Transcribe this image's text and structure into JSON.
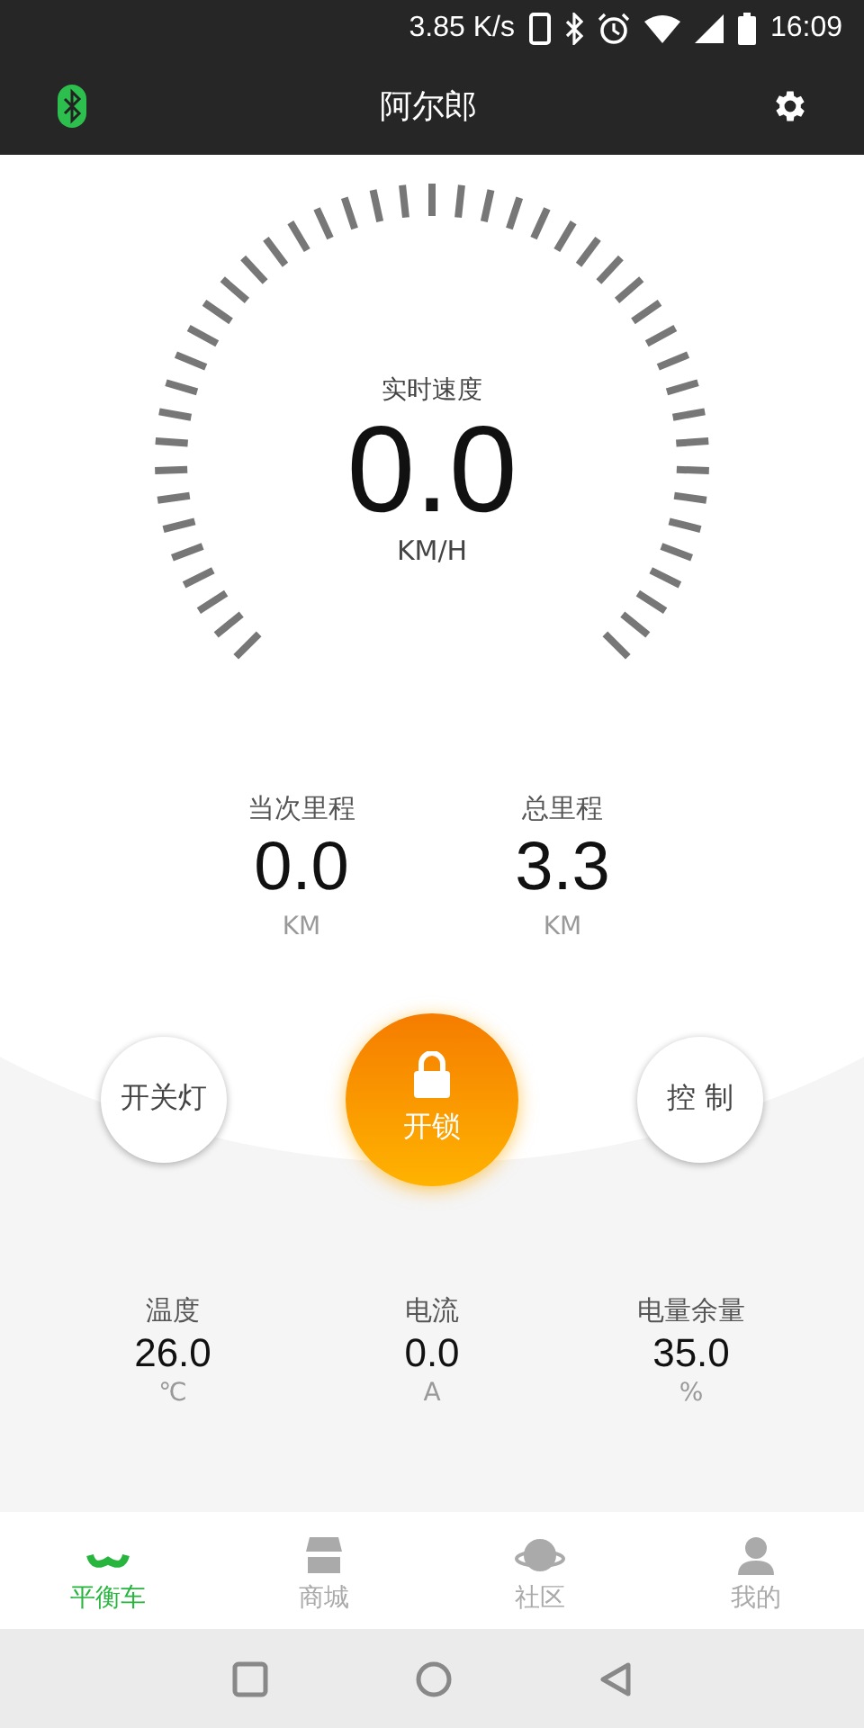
{
  "status_bar": {
    "net_speed": "3.85 K/s",
    "time": "16:09"
  },
  "app_bar": {
    "title": "阿尔郎"
  },
  "speed": {
    "label": "实时速度",
    "value": "0.0",
    "unit": "KM/H"
  },
  "trips": [
    {
      "label": "当次里程",
      "value": "0.0",
      "unit": "KM"
    },
    {
      "label": "总里程",
      "value": "3.3",
      "unit": "KM"
    }
  ],
  "actions": [
    {
      "kind": "side",
      "label": "开关灯"
    },
    {
      "kind": "main",
      "label": "开锁"
    },
    {
      "kind": "side",
      "label": "控 制"
    }
  ],
  "stats": [
    {
      "label": "温度",
      "value": "26.0",
      "unit": "℃"
    },
    {
      "label": "电流",
      "value": "0.0",
      "unit": "A"
    },
    {
      "label": "电量余量",
      "value": "35.0",
      "unit": "%"
    }
  ],
  "tabs": [
    {
      "kind": "scooter",
      "label": "平衡车",
      "selected": true
    },
    {
      "kind": "shop",
      "label": "商城",
      "selected": false
    },
    {
      "kind": "planet",
      "label": "社区",
      "selected": false
    },
    {
      "kind": "person",
      "label": "我的",
      "selected": false
    }
  ]
}
